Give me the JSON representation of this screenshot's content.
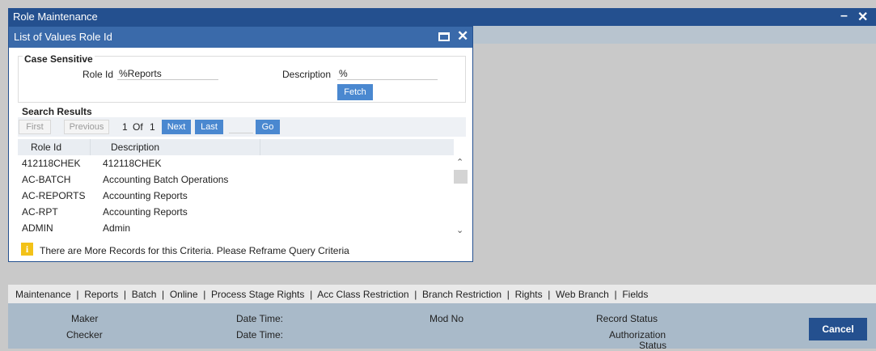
{
  "window": {
    "title": "Role Maintenance",
    "minimize": "–",
    "close": "✕"
  },
  "lov": {
    "title": "List of Values Role Id",
    "close": "✕",
    "case_sensitive_label": "Case Sensitive",
    "role_id_label": "Role Id",
    "role_id_value": "%Reports",
    "description_label": "Description",
    "description_value": "%",
    "fetch_label": "Fetch",
    "search_results_label": "Search Results",
    "pager": {
      "first": "First",
      "previous": "Previous",
      "current": "1",
      "of": "Of",
      "total": "1",
      "next": "Next",
      "last": "Last",
      "go": "Go"
    },
    "columns": [
      "Role Id",
      "Description"
    ],
    "rows": [
      {
        "role_id": "412118CHEK",
        "description": "412118CHEK"
      },
      {
        "role_id": "AC-BATCH",
        "description": "Accounting Batch Operations"
      },
      {
        "role_id": "AC-REPORTS",
        "description": "Accounting Reports"
      },
      {
        "role_id": "AC-RPT",
        "description": "Accounting Reports"
      },
      {
        "role_id": "ADMIN",
        "description": "Admin"
      }
    ],
    "warning_icon": "i",
    "warning": "There are More Records for this Criteria. Please Reframe Query Criteria"
  },
  "tabs": [
    "Maintenance",
    "Reports",
    "Batch",
    "Online",
    "Process Stage Rights",
    "Acc Class Restriction",
    "Branch Restriction",
    "Rights",
    "Web Branch",
    "Fields"
  ],
  "tab_separator": "|",
  "footer": {
    "maker": "Maker",
    "checker": "Checker",
    "date_time_1": "Date Time:",
    "date_time_2": "Date Time:",
    "mod_no": "Mod No",
    "record_status": "Record Status",
    "authorization_status_1": "Authorization",
    "authorization_status_2": "Status",
    "cancel": "Cancel"
  },
  "colors": {
    "title_bar": "#24508f",
    "accent_button": "#4a88d0",
    "warning": "#f3c218"
  }
}
